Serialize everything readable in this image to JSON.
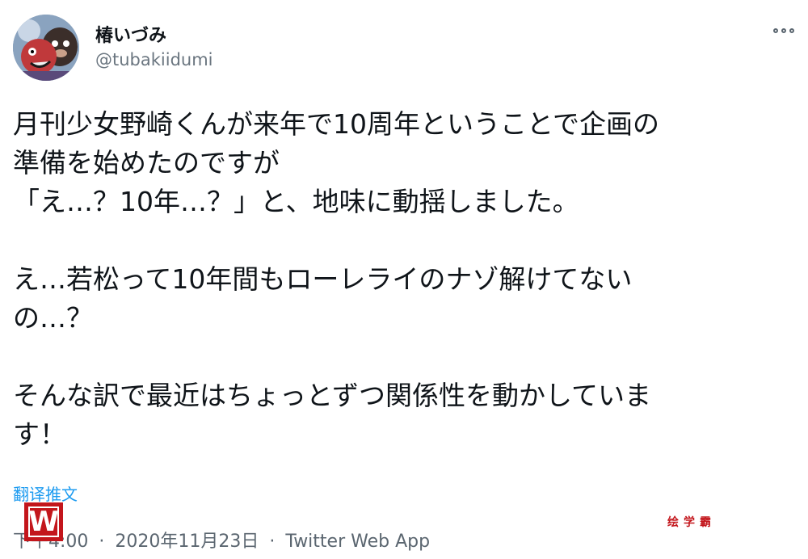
{
  "user": {
    "display_name": "椿いづみ",
    "handle": "@tubakiidumi",
    "avatar": "avatar-illustration"
  },
  "more_menu": {
    "icon": "more-dots-icon"
  },
  "tweet": {
    "text": "月刊少女野崎くんが来年で10周年ということで企画の\n準備を始めたのですが\n「え…？10年…？」と、地味に動揺しました。\n\nえ…若松って10年間もローレライのナゾ解けてない\nの…？\n\nそんな訳で最近はちょっとずつ関係性を動かしていま\nす！",
    "translate_label": "翻译推文"
  },
  "meta": {
    "time": "下午4:00",
    "separator": "·",
    "date": "2020年11月23日",
    "source": "Twitter Web App"
  },
  "watermark": {
    "logo_letter": "W",
    "text": "绘学霸",
    "color": "#c3161c"
  }
}
